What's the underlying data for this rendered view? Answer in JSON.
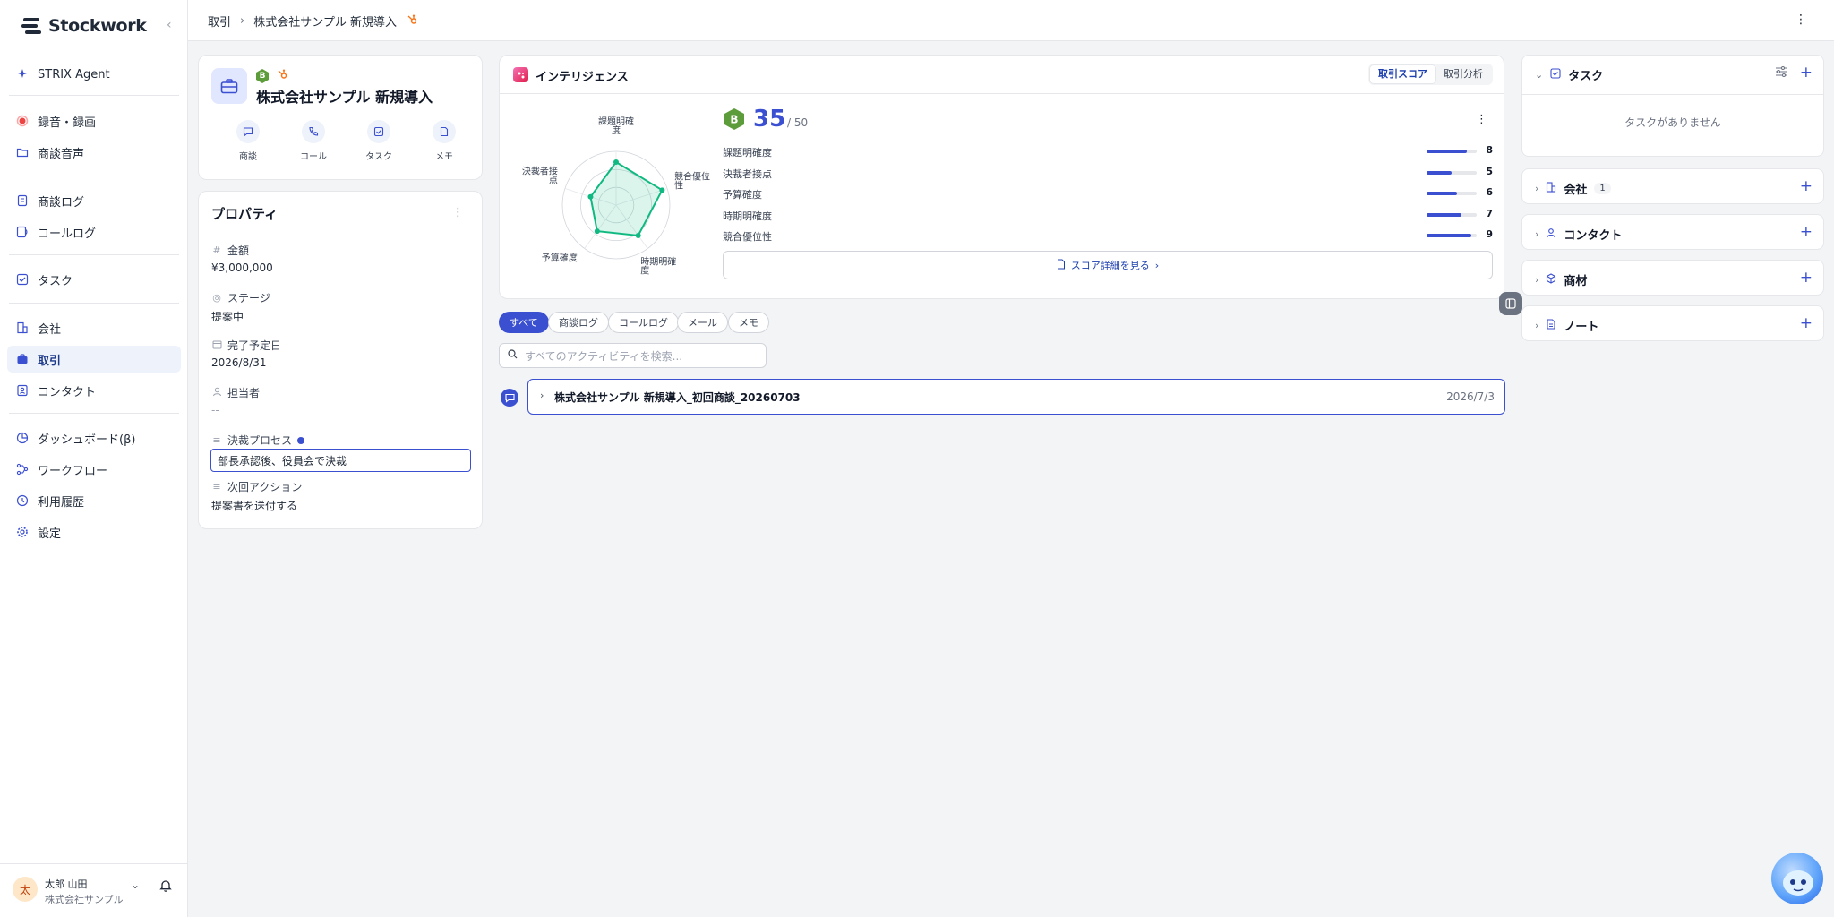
{
  "app": {
    "name": "Stockwork"
  },
  "sidebar": {
    "items": [
      {
        "label": "STRIX Agent",
        "icon": "sparkle-icon"
      },
      {
        "label": "録音・録画",
        "icon": "record-icon"
      },
      {
        "label": "商談音声",
        "icon": "folder-icon"
      },
      {
        "label": "商談ログ",
        "icon": "document-icon"
      },
      {
        "label": "コールログ",
        "icon": "call-log-icon"
      },
      {
        "label": "タスク",
        "icon": "task-icon"
      },
      {
        "label": "会社",
        "icon": "building-icon"
      },
      {
        "label": "取引",
        "icon": "briefcase-icon",
        "active": true
      },
      {
        "label": "コンタクト",
        "icon": "contact-icon"
      },
      {
        "label": "ダッシュボード(β)",
        "icon": "dashboard-icon"
      },
      {
        "label": "ワークフロー",
        "icon": "workflow-icon"
      },
      {
        "label": "利用履歴",
        "icon": "history-icon"
      },
      {
        "label": "設定",
        "icon": "gear-icon"
      }
    ]
  },
  "user": {
    "initial": "太",
    "name": "太郎 山田",
    "company": "株式会社サンプル"
  },
  "breadcrumb": {
    "parent": "取引",
    "current": "株式会社サンプル 新規導入"
  },
  "deal": {
    "grade": "B",
    "title": "株式会社サンプル 新規導入",
    "actions": [
      {
        "label": "商談",
        "icon": "chat-icon"
      },
      {
        "label": "コール",
        "icon": "phone-icon"
      },
      {
        "label": "タスク",
        "icon": "task-check-icon"
      },
      {
        "label": "メモ",
        "icon": "memo-icon"
      }
    ]
  },
  "properties": {
    "title": "プロパティ",
    "amount_label": "金額",
    "amount": "¥3,000,000",
    "stage_label": "ステージ",
    "stage": "提案中",
    "close_date_label": "完了予定日",
    "close_date": "2026/8/31",
    "owner_label": "担当者",
    "owner": "--",
    "decision_label": "決裁プロセス",
    "decision": "部長承認後、役員会で決裁",
    "next_action_label": "次回アクション",
    "next_action": "提案書を送付する"
  },
  "intelligence": {
    "title": "インテリジェンス",
    "tabs": [
      "取引スコア",
      "取引分析"
    ],
    "active_tab": "取引スコア",
    "grade": "B",
    "score": "35",
    "score_max": "/ 50",
    "detail_button": "スコア詳細を見る"
  },
  "chart_data": {
    "type": "radar",
    "max": 10,
    "axes": [
      "課題明確度",
      "競合優位性",
      "時期明確度",
      "予算確度",
      "決裁者接点"
    ],
    "radar_labels": [
      "課題明確\n度",
      "競合優位\n性",
      "時期明確\n度",
      "予算確度",
      "決裁者接\n点"
    ],
    "values": [
      8,
      9,
      7,
      6,
      5
    ],
    "metrics": [
      {
        "label": "課題明確度",
        "value": 8
      },
      {
        "label": "決裁者接点",
        "value": 5
      },
      {
        "label": "予算確度",
        "value": 6
      },
      {
        "label": "時期明確度",
        "value": 7
      },
      {
        "label": "競合優位性",
        "value": 9
      }
    ],
    "color": "#10b981"
  },
  "filters": [
    "すべて",
    "商談ログ",
    "コールログ",
    "メール",
    "メモ"
  ],
  "active_filter": "すべて",
  "search": {
    "placeholder": "すべてのアクティビティを検索..."
  },
  "activity": {
    "title": "株式会社サンプル 新規導入_初回商談_20260703",
    "date": "2026/7/3"
  },
  "right_panel": {
    "tasks": {
      "title": "タスク",
      "empty": "タスクがありません"
    },
    "company": {
      "title": "会社",
      "count": "1"
    },
    "contact": {
      "title": "コンタクト"
    },
    "product": {
      "title": "商材"
    },
    "note": {
      "title": "ノート"
    }
  },
  "colors": {
    "accent": "#3b4fd1",
    "grade": "#5d9c3a",
    "radar": "#10b981"
  }
}
